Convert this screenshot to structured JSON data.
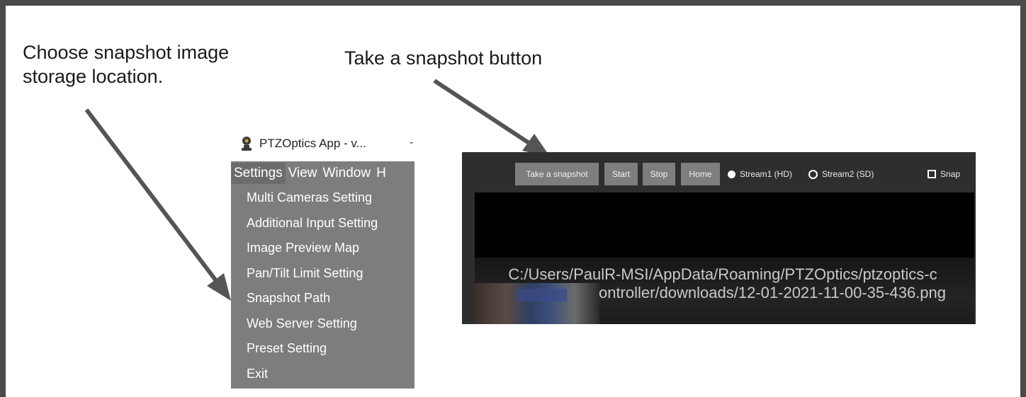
{
  "annotations": {
    "left_line1": "Choose snapshot image",
    "left_line2": "storage location.",
    "right": "Take a snapshot button"
  },
  "app": {
    "title": "PTZOptics App - v...",
    "title_dash": "-",
    "menubar": [
      "Settings",
      "View",
      "Window",
      "H"
    ],
    "settings_menu": [
      "Multi Cameras Setting",
      "Additional Input Setting",
      "Image Preview Map",
      "Pan/Tilt Limit Setting",
      "Snapshot Path",
      "Web Server Setting",
      "Preset Setting",
      "Exit"
    ]
  },
  "panel": {
    "buttons": {
      "snapshot": "Take a snapshot",
      "start": "Start",
      "stop": "Stop",
      "home": "Home"
    },
    "stream1_label": "Stream1 (HD)",
    "stream2_label": "Stream2 (SD)",
    "snap_label": "Snap",
    "stream1_selected": true,
    "stream2_selected": false,
    "snap_checked": false,
    "snapshot_path_line1": "C:/Users/PaulR-MSI/AppData/Roaming/PTZOptics/ptzoptics-c",
    "snapshot_path_line2": "ontroller/downloads/12-01-2021-11-00-35-436.png"
  },
  "colors": {
    "frame": "#4a4a4a",
    "arrow": "#555555",
    "menu_bg": "#7d7d7d",
    "panel_bg": "#2e2e2e"
  }
}
